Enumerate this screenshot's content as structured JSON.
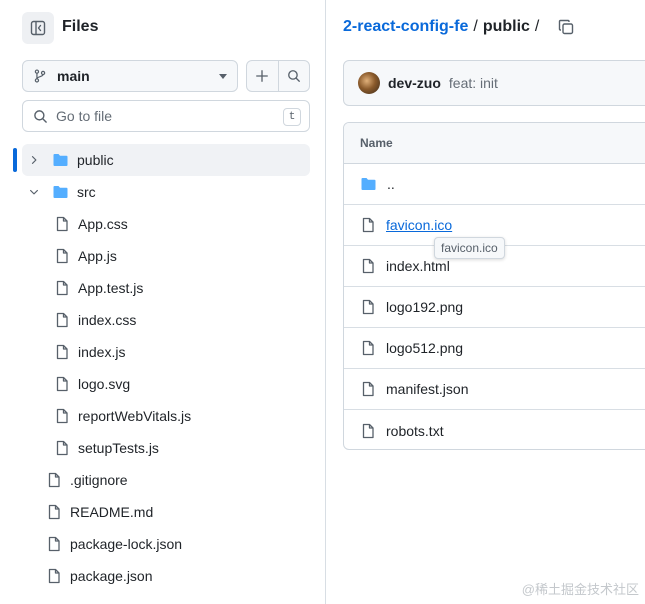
{
  "sidebar": {
    "title": "Files",
    "branch": "main",
    "search_placeholder": "Go to file",
    "search_shortcut": "t",
    "tree": [
      {
        "name": "public",
        "type": "folder",
        "level": 0,
        "expanded": false,
        "selected": true
      },
      {
        "name": "src",
        "type": "folder",
        "level": 0,
        "expanded": true,
        "selected": false
      },
      {
        "name": "App.css",
        "type": "file",
        "level": 1
      },
      {
        "name": "App.js",
        "type": "file",
        "level": 1
      },
      {
        "name": "App.test.js",
        "type": "file",
        "level": 1
      },
      {
        "name": "index.css",
        "type": "file",
        "level": 1
      },
      {
        "name": "index.js",
        "type": "file",
        "level": 1
      },
      {
        "name": "logo.svg",
        "type": "file",
        "level": 1
      },
      {
        "name": "reportWebVitals.js",
        "type": "file",
        "level": 1
      },
      {
        "name": "setupTests.js",
        "type": "file",
        "level": 1
      },
      {
        "name": ".gitignore",
        "type": "file",
        "level": 0
      },
      {
        "name": "README.md",
        "type": "file",
        "level": 0
      },
      {
        "name": "package-lock.json",
        "type": "file",
        "level": 0
      },
      {
        "name": "package.json",
        "type": "file",
        "level": 0
      }
    ]
  },
  "breadcrumb": {
    "repo": "2-react-config-fe",
    "sep1": "/",
    "current": "public",
    "sep2": "/"
  },
  "commit": {
    "user": "dev-zuo",
    "message": "feat: init"
  },
  "file_table": {
    "header": "Name",
    "rows": [
      {
        "name": "..",
        "type": "folder"
      },
      {
        "name": "favicon.ico",
        "type": "file",
        "hovered": true
      },
      {
        "name": "index.html",
        "type": "file"
      },
      {
        "name": "logo192.png",
        "type": "file"
      },
      {
        "name": "logo512.png",
        "type": "file"
      },
      {
        "name": "manifest.json",
        "type": "file"
      },
      {
        "name": "robots.txt",
        "type": "file"
      }
    ]
  },
  "tooltip": "favicon.ico",
  "watermark": "@稀土掘金技术社区",
  "colors": {
    "accent": "#0969da",
    "folder": "#54aeff",
    "border": "#d0d7de",
    "text": "#1f2328",
    "muted": "#656d76"
  }
}
